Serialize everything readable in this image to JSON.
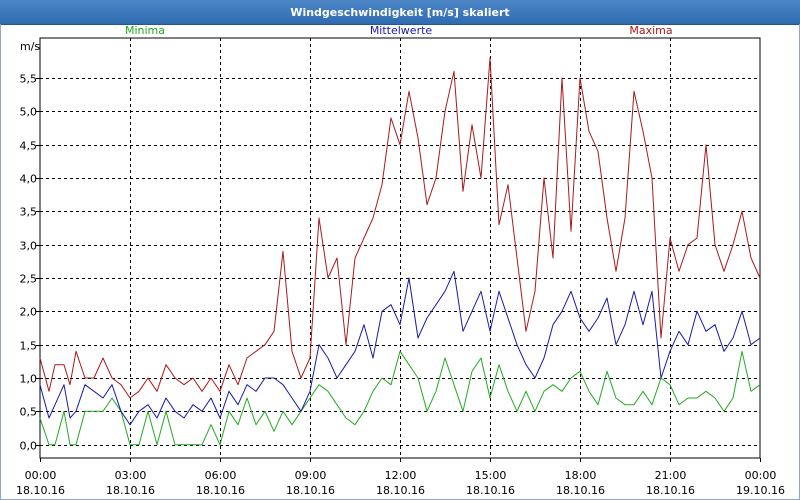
{
  "window": {
    "title": "Windgeschwindigkeit [m/s] skaliert"
  },
  "colors": {
    "minima": "#22aa22",
    "mittelwerte": "#1a1aaa",
    "maxima": "#aa1a1a",
    "grid": "#000000",
    "titlebar": "#3a78bd"
  },
  "chart_data": {
    "type": "line",
    "title": "Windgeschwindigkeit [m/s] skaliert",
    "ylabel": "m/s",
    "ylim": [
      -0.2,
      6.1
    ],
    "yticks": [
      0.0,
      0.5,
      1.0,
      1.5,
      2.0,
      2.5,
      3.0,
      3.5,
      4.0,
      4.5,
      5.0,
      5.5
    ],
    "ytick_labels": [
      "0,0",
      "0,5",
      "1,0",
      "1,5",
      "2,0",
      "2,5",
      "3,0",
      "3,5",
      "4,0",
      "4,5",
      "5,0",
      "5,5"
    ],
    "xlim_hours": [
      0,
      24
    ],
    "xticks": [
      {
        "time": "00:00",
        "date": "18.10.16",
        "hour": 0
      },
      {
        "time": "03:00",
        "date": "18.10.16",
        "hour": 3
      },
      {
        "time": "06:00",
        "date": "18.10.16",
        "hour": 6
      },
      {
        "time": "09:00",
        "date": "18.10.16",
        "hour": 9
      },
      {
        "time": "12:00",
        "date": "18.10.16",
        "hour": 12
      },
      {
        "time": "15:00",
        "date": "18.10.16",
        "hour": 15
      },
      {
        "time": "18:00",
        "date": "18.10.16",
        "hour": 18
      },
      {
        "time": "21:00",
        "date": "18.10.16",
        "hour": 21
      },
      {
        "time": "00:00",
        "date": "19.10.16",
        "hour": 24
      }
    ],
    "grid": true,
    "legend_placement": "top",
    "series": [
      {
        "name": "Minima",
        "points": [
          [
            0,
            0.4
          ],
          [
            0.3,
            0.0
          ],
          [
            0.5,
            0.0
          ],
          [
            0.8,
            0.5
          ],
          [
            1.0,
            0.0
          ],
          [
            1.2,
            0.0
          ],
          [
            1.5,
            0.5
          ],
          [
            1.8,
            0.5
          ],
          [
            2.1,
            0.5
          ],
          [
            2.4,
            0.7
          ],
          [
            2.7,
            0.5
          ],
          [
            3.0,
            0.0
          ],
          [
            3.3,
            0.0
          ],
          [
            3.6,
            0.5
          ],
          [
            3.9,
            0.0
          ],
          [
            4.2,
            0.5
          ],
          [
            4.5,
            0.0
          ],
          [
            4.8,
            0.0
          ],
          [
            5.1,
            0.0
          ],
          [
            5.4,
            0.0
          ],
          [
            5.7,
            0.3
          ],
          [
            6.0,
            0.0
          ],
          [
            6.3,
            0.5
          ],
          [
            6.6,
            0.3
          ],
          [
            6.9,
            0.7
          ],
          [
            7.2,
            0.3
          ],
          [
            7.5,
            0.5
          ],
          [
            7.8,
            0.2
          ],
          [
            8.1,
            0.5
          ],
          [
            8.4,
            0.3
          ],
          [
            8.7,
            0.5
          ],
          [
            9.0,
            0.7
          ],
          [
            9.3,
            0.9
          ],
          [
            9.6,
            0.8
          ],
          [
            9.9,
            0.6
          ],
          [
            10.2,
            0.4
          ],
          [
            10.5,
            0.3
          ],
          [
            10.8,
            0.5
          ],
          [
            11.1,
            0.8
          ],
          [
            11.4,
            1.0
          ],
          [
            11.7,
            0.9
          ],
          [
            12.0,
            1.4
          ],
          [
            12.3,
            1.2
          ],
          [
            12.6,
            1.0
          ],
          [
            12.9,
            0.5
          ],
          [
            13.2,
            0.8
          ],
          [
            13.5,
            1.3
          ],
          [
            13.8,
            0.9
          ],
          [
            14.1,
            0.5
          ],
          [
            14.4,
            1.1
          ],
          [
            14.7,
            1.3
          ],
          [
            15.0,
            0.7
          ],
          [
            15.3,
            1.2
          ],
          [
            15.6,
            0.8
          ],
          [
            15.9,
            0.5
          ],
          [
            16.2,
            0.8
          ],
          [
            16.5,
            0.5
          ],
          [
            16.8,
            0.8
          ],
          [
            17.1,
            0.9
          ],
          [
            17.4,
            0.8
          ],
          [
            17.7,
            1.0
          ],
          [
            18.0,
            1.1
          ],
          [
            18.3,
            0.8
          ],
          [
            18.6,
            0.6
          ],
          [
            18.9,
            1.1
          ],
          [
            19.2,
            0.7
          ],
          [
            19.5,
            0.6
          ],
          [
            19.8,
            0.6
          ],
          [
            20.1,
            0.8
          ],
          [
            20.4,
            0.6
          ],
          [
            20.7,
            1.0
          ],
          [
            21.0,
            0.9
          ],
          [
            21.3,
            0.6
          ],
          [
            21.6,
            0.7
          ],
          [
            21.9,
            0.7
          ],
          [
            22.2,
            0.8
          ],
          [
            22.5,
            0.7
          ],
          [
            22.8,
            0.5
          ],
          [
            23.1,
            0.7
          ],
          [
            23.4,
            1.4
          ],
          [
            23.7,
            0.8
          ],
          [
            24.0,
            0.9
          ]
        ]
      },
      {
        "name": "Mittelwerte",
        "points": [
          [
            0,
            0.9
          ],
          [
            0.3,
            0.4
          ],
          [
            0.5,
            0.6
          ],
          [
            0.8,
            0.9
          ],
          [
            1.0,
            0.4
          ],
          [
            1.2,
            0.5
          ],
          [
            1.5,
            0.9
          ],
          [
            1.8,
            0.8
          ],
          [
            2.1,
            0.7
          ],
          [
            2.4,
            0.9
          ],
          [
            2.7,
            0.5
          ],
          [
            3.0,
            0.3
          ],
          [
            3.3,
            0.5
          ],
          [
            3.6,
            0.6
          ],
          [
            3.9,
            0.4
          ],
          [
            4.2,
            0.7
          ],
          [
            4.5,
            0.5
          ],
          [
            4.8,
            0.4
          ],
          [
            5.1,
            0.6
          ],
          [
            5.4,
            0.5
          ],
          [
            5.7,
            0.7
          ],
          [
            6.0,
            0.4
          ],
          [
            6.3,
            0.8
          ],
          [
            6.6,
            0.6
          ],
          [
            6.9,
            0.9
          ],
          [
            7.2,
            0.8
          ],
          [
            7.5,
            1.0
          ],
          [
            7.8,
            1.0
          ],
          [
            8.1,
            0.9
          ],
          [
            8.4,
            0.7
          ],
          [
            8.7,
            0.5
          ],
          [
            9.0,
            0.8
          ],
          [
            9.3,
            1.5
          ],
          [
            9.6,
            1.3
          ],
          [
            9.9,
            1.0
          ],
          [
            10.2,
            1.2
          ],
          [
            10.5,
            1.4
          ],
          [
            10.8,
            1.8
          ],
          [
            11.1,
            1.3
          ],
          [
            11.4,
            2.0
          ],
          [
            11.7,
            2.1
          ],
          [
            12.0,
            1.8
          ],
          [
            12.3,
            2.5
          ],
          [
            12.6,
            1.6
          ],
          [
            12.9,
            1.9
          ],
          [
            13.2,
            2.1
          ],
          [
            13.5,
            2.3
          ],
          [
            13.8,
            2.6
          ],
          [
            14.1,
            1.7
          ],
          [
            14.4,
            2.0
          ],
          [
            14.7,
            2.3
          ],
          [
            15.0,
            1.7
          ],
          [
            15.3,
            2.3
          ],
          [
            15.6,
            1.9
          ],
          [
            15.9,
            1.5
          ],
          [
            16.2,
            1.2
          ],
          [
            16.5,
            1.0
          ],
          [
            16.8,
            1.3
          ],
          [
            17.1,
            1.8
          ],
          [
            17.4,
            2.0
          ],
          [
            17.7,
            2.3
          ],
          [
            18.0,
            1.9
          ],
          [
            18.3,
            1.7
          ],
          [
            18.6,
            1.9
          ],
          [
            18.9,
            2.2
          ],
          [
            19.2,
            1.5
          ],
          [
            19.5,
            1.8
          ],
          [
            19.8,
            2.3
          ],
          [
            20.1,
            1.8
          ],
          [
            20.4,
            2.3
          ],
          [
            20.7,
            1.0
          ],
          [
            21.0,
            1.4
          ],
          [
            21.3,
            1.7
          ],
          [
            21.6,
            1.5
          ],
          [
            21.9,
            2.0
          ],
          [
            22.2,
            1.7
          ],
          [
            22.5,
            1.8
          ],
          [
            22.8,
            1.4
          ],
          [
            23.1,
            1.6
          ],
          [
            23.4,
            2.0
          ],
          [
            23.7,
            1.5
          ],
          [
            24.0,
            1.6
          ]
        ]
      },
      {
        "name": "Maxima",
        "points": [
          [
            0,
            1.3
          ],
          [
            0.3,
            0.8
          ],
          [
            0.5,
            1.2
          ],
          [
            0.8,
            1.2
          ],
          [
            1.0,
            0.9
          ],
          [
            1.2,
            1.4
          ],
          [
            1.5,
            1.0
          ],
          [
            1.8,
            1.0
          ],
          [
            2.1,
            1.3
          ],
          [
            2.4,
            1.0
          ],
          [
            2.7,
            0.9
          ],
          [
            3.0,
            0.7
          ],
          [
            3.3,
            0.8
          ],
          [
            3.6,
            1.0
          ],
          [
            3.9,
            0.8
          ],
          [
            4.2,
            1.2
          ],
          [
            4.5,
            1.0
          ],
          [
            4.8,
            0.9
          ],
          [
            5.1,
            1.0
          ],
          [
            5.4,
            0.8
          ],
          [
            5.7,
            1.0
          ],
          [
            6.0,
            0.8
          ],
          [
            6.3,
            1.2
          ],
          [
            6.6,
            0.9
          ],
          [
            6.9,
            1.3
          ],
          [
            7.2,
            1.4
          ],
          [
            7.5,
            1.5
          ],
          [
            7.8,
            1.7
          ],
          [
            8.1,
            2.9
          ],
          [
            8.4,
            1.4
          ],
          [
            8.7,
            1.0
          ],
          [
            9.0,
            1.3
          ],
          [
            9.3,
            3.4
          ],
          [
            9.6,
            2.5
          ],
          [
            9.9,
            2.8
          ],
          [
            10.2,
            1.5
          ],
          [
            10.5,
            2.8
          ],
          [
            10.8,
            3.1
          ],
          [
            11.1,
            3.4
          ],
          [
            11.4,
            3.9
          ],
          [
            11.7,
            4.9
          ],
          [
            12.0,
            4.5
          ],
          [
            12.3,
            5.3
          ],
          [
            12.6,
            4.6
          ],
          [
            12.9,
            3.6
          ],
          [
            13.2,
            4.0
          ],
          [
            13.5,
            5.0
          ],
          [
            13.8,
            5.6
          ],
          [
            14.1,
            3.8
          ],
          [
            14.4,
            4.8
          ],
          [
            14.7,
            4.0
          ],
          [
            15.0,
            5.8
          ],
          [
            15.3,
            3.3
          ],
          [
            15.6,
            3.9
          ],
          [
            15.9,
            2.8
          ],
          [
            16.2,
            1.7
          ],
          [
            16.5,
            2.3
          ],
          [
            16.8,
            4.0
          ],
          [
            17.1,
            2.8
          ],
          [
            17.4,
            5.5
          ],
          [
            17.7,
            3.2
          ],
          [
            18.0,
            5.5
          ],
          [
            18.3,
            4.7
          ],
          [
            18.6,
            4.4
          ],
          [
            18.9,
            3.4
          ],
          [
            19.2,
            2.6
          ],
          [
            19.5,
            3.4
          ],
          [
            19.8,
            5.3
          ],
          [
            20.1,
            4.7
          ],
          [
            20.4,
            4.0
          ],
          [
            20.7,
            1.6
          ],
          [
            21.0,
            3.1
          ],
          [
            21.3,
            2.6
          ],
          [
            21.6,
            3.0
          ],
          [
            21.9,
            3.1
          ],
          [
            22.2,
            4.5
          ],
          [
            22.5,
            3.0
          ],
          [
            22.8,
            2.6
          ],
          [
            23.1,
            3.0
          ],
          [
            23.4,
            3.5
          ],
          [
            23.7,
            2.8
          ],
          [
            24.0,
            2.5
          ]
        ]
      }
    ]
  }
}
